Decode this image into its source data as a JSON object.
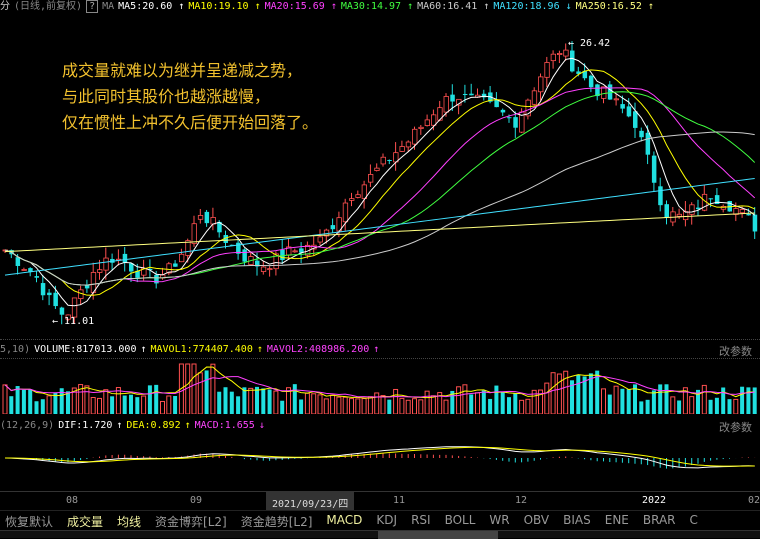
{
  "header": {
    "prefix": "分",
    "title": "(日线,前复权)",
    "help": "?",
    "ma_label": "MA",
    "ma": [
      {
        "text": "MA5:20.60",
        "arrow": "↑",
        "color": "#ffffff"
      },
      {
        "text": "MA10:19.10",
        "arrow": "↑",
        "color": "#ffff00"
      },
      {
        "text": "MA20:15.69",
        "arrow": "↑",
        "color": "#ff40ff"
      },
      {
        "text": "MA30:14.97",
        "arrow": "↑",
        "color": "#40ff40"
      },
      {
        "text": "MA60:16.41",
        "arrow": "↑",
        "color": "#cccccc"
      },
      {
        "text": "MA120:18.96",
        "arrow": "↓",
        "color": "#40e0ff"
      },
      {
        "text": "MA250:16.52",
        "arrow": "↑",
        "color": "#ffff80"
      }
    ]
  },
  "annotation": {
    "lines": [
      "成交量就难以为继并呈递减之势，",
      "与此同时其股价也越涨越慢，",
      "仅在惯性上冲不久后便开始回落了。"
    ]
  },
  "price_marks": {
    "high": "26.42",
    "low": "11.01"
  },
  "volume": {
    "params": "5,10)",
    "value": "VOLUME:817013.000",
    "v_arrow": "↑",
    "mavol1": "MAVOL1:774407.400",
    "m1_arrow": "↑",
    "mavol2": "MAVOL2:408986.200",
    "m2_arrow": "↑",
    "param_btn": "改参数"
  },
  "macd": {
    "params": "(12,26,9)",
    "dif": "DIF:1.720",
    "dif_arrow": "↑",
    "dea": "DEA:0.892",
    "dea_arrow": "↑",
    "macd": "MACD:1.655",
    "macd_arrow": "↓",
    "param_btn": "改参数"
  },
  "xaxis": {
    "labels": [
      "08",
      "09",
      "11",
      "12",
      "2022",
      "02"
    ],
    "cursor_date": "2021/09/23/四"
  },
  "tabs": [
    "恢复默认",
    "成交量",
    "均线",
    "资金博弈[L2]",
    "资金趋势[L2]",
    "MACD",
    "KDJ",
    "RSI",
    "BOLL",
    "WR",
    "OBV",
    "BIAS",
    "ENE",
    "BRAR",
    "C"
  ],
  "colors": {
    "up": "#ff5050",
    "down": "#20e0e0",
    "note": "#f2c12e"
  },
  "chart_data": {
    "type": "candlestick",
    "price_range": [
      11.01,
      26.42
    ],
    "closes": [
      14.9,
      14.2,
      13.5,
      12.0,
      11.2,
      12.5,
      13.8,
      14.5,
      14.2,
      13.6,
      13.3,
      13.8,
      15.0,
      17.0,
      16.2,
      15.2,
      14.5,
      14.0,
      14.3,
      14.8,
      15.0,
      15.4,
      16.5,
      18.0,
      18.6,
      19.5,
      20.3,
      21.0,
      22.0,
      23.0,
      23.5,
      23.2,
      23.0,
      22.5,
      22.0,
      23.5,
      25.0,
      26.0,
      25.0,
      24.0,
      23.5,
      22.8,
      22.0,
      19.5,
      17.0,
      16.7,
      17.2,
      18.0,
      17.6,
      17.0,
      16.2
    ]
  }
}
